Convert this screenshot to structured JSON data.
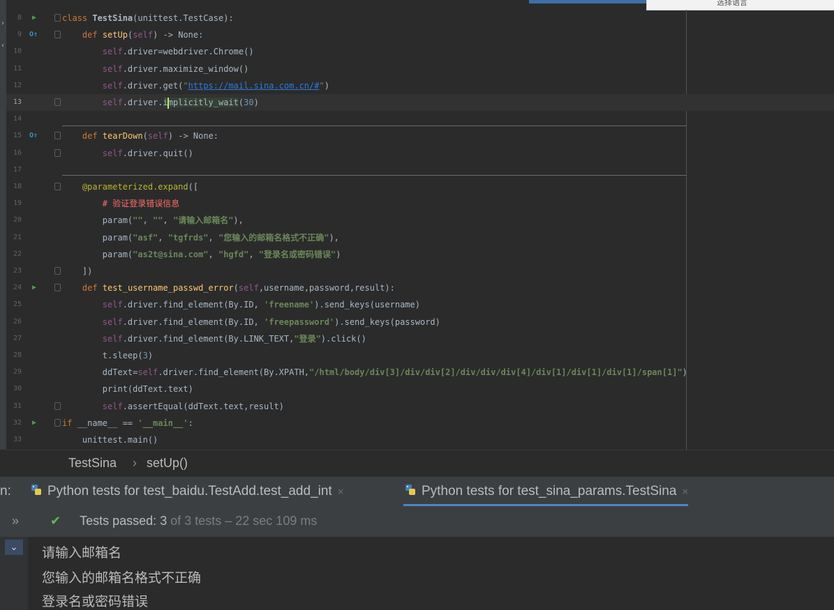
{
  "top_popup": {
    "text": "选择语言"
  },
  "lines": [
    {
      "n": "8",
      "html": "<span class=\"kw\">class</span> <span class=\"bold\">TestSina</span>(unittest.TestCase):"
    },
    {
      "n": "9",
      "html": "    <span class=\"kw\">def</span> <span class=\"fn\">setUp</span>(<span class=\"self\">self</span>) -&gt; None:"
    },
    {
      "n": "10",
      "html": "        <span class=\"self\">self</span>.driver=webdriver.Chrome()"
    },
    {
      "n": "11",
      "html": "        <span class=\"self\">self</span>.driver.maximize_window()"
    },
    {
      "n": "12",
      "html": "        <span class=\"self\">self</span>.driver.get(<span class=\"str\">\"</span><span class=\"url\">https://mail.sina.com.cn/#</span><span class=\"str\">\"</span>)"
    },
    {
      "n": "13",
      "html": "        <span class=\"self\">self</span>.driver.<span class=\"hl\">i<span class=\"cursor\"></span>mplicitly_wait</span>(<span class=\"num\">30</span>)"
    },
    {
      "n": "14",
      "html": ""
    },
    {
      "n": "15",
      "html": "    <span class=\"kw\">def</span> <span class=\"fn\">tearDown</span>(<span class=\"self\">self</span>) -&gt; None:"
    },
    {
      "n": "16",
      "html": "        <span class=\"self\">self</span>.driver.quit()"
    },
    {
      "n": "17",
      "html": ""
    },
    {
      "n": "18",
      "html": "    <span class=\"dec\">@parameterized.expand</span>(["
    },
    {
      "n": "19",
      "html": "        <span class=\"cm\"># 验证登录错误信息</span>"
    },
    {
      "n": "20",
      "html": "        param(<span class=\"strb\">\"\"</span>, <span class=\"strb\">\"\"</span>, <span class=\"strb\">\"请输入邮箱名\"</span>),"
    },
    {
      "n": "21",
      "html": "        param(<span class=\"strb\">\"asf\"</span>, <span class=\"strb\">\"tgfrds\"</span>, <span class=\"strb\">\"您输入的邮箱名格式不正确\"</span>),"
    },
    {
      "n": "22",
      "html": "        param(<span class=\"strb\">\"as2t@sina.com\"</span>, <span class=\"strb\">\"hgfd\"</span>, <span class=\"strb\">\"登录名或密码错误\"</span>)"
    },
    {
      "n": "23",
      "html": "    ])"
    },
    {
      "n": "24",
      "html": "    <span class=\"kw\">def</span> <span class=\"fn\">test_username_passwd_error</span>(<span class=\"self\">self</span>,username,password,result):"
    },
    {
      "n": "25",
      "html": "        <span class=\"self\">self</span>.driver.find_element(By.ID, <span class=\"strb\">'freename'</span>).send_keys(username)"
    },
    {
      "n": "26",
      "html": "        <span class=\"self\">self</span>.driver.find_element(By.ID, <span class=\"strb\">'freepassword'</span>).send_keys(password)"
    },
    {
      "n": "27",
      "html": "        <span class=\"self\">self</span>.driver.find_element(By.LINK_TEXT,<span class=\"strb\">\"登录\"</span>).click()"
    },
    {
      "n": "28",
      "html": "        t.sleep(<span class=\"num\">3</span>)"
    },
    {
      "n": "29",
      "html": "        ddText=<span class=\"self\">self</span>.driver.find_element(By.XPATH,<span class=\"strb\">\"/html/body/div[3]/div/div[2]/div/div/div[4]/div[1]/div[1]/div[1]/span[1]\"</span>)"
    },
    {
      "n": "30",
      "html": "        print(ddText.text)"
    },
    {
      "n": "31",
      "html": "        <span class=\"self\">self</span>.assertEqual(ddText.text,result)"
    },
    {
      "n": "32",
      "html": "<span class=\"kw\">if</span> __name__ == <span class=\"strb\">'__main__'</span>:"
    },
    {
      "n": "33",
      "html": "    unittest.main()"
    }
  ],
  "breadcrumb": {
    "class": "TestSina",
    "sep": "›",
    "method": "setUp()"
  },
  "tabs": {
    "prefix": "n:",
    "tab1": "Python tests for test_baidu.TestAdd.test_add_int",
    "tab2": "Python tests for test_sina_params.TestSina",
    "close": "×"
  },
  "status": {
    "expand": "»",
    "check": "✔",
    "label": "Tests passed:",
    "count": "3",
    "rest": "of 3 tests – 22 sec 109 ms"
  },
  "output": {
    "chevron": "⌄",
    "lines": [
      "请输入邮箱名",
      "您输入的邮箱名格式不正确",
      "登录名或密码错误"
    ]
  }
}
